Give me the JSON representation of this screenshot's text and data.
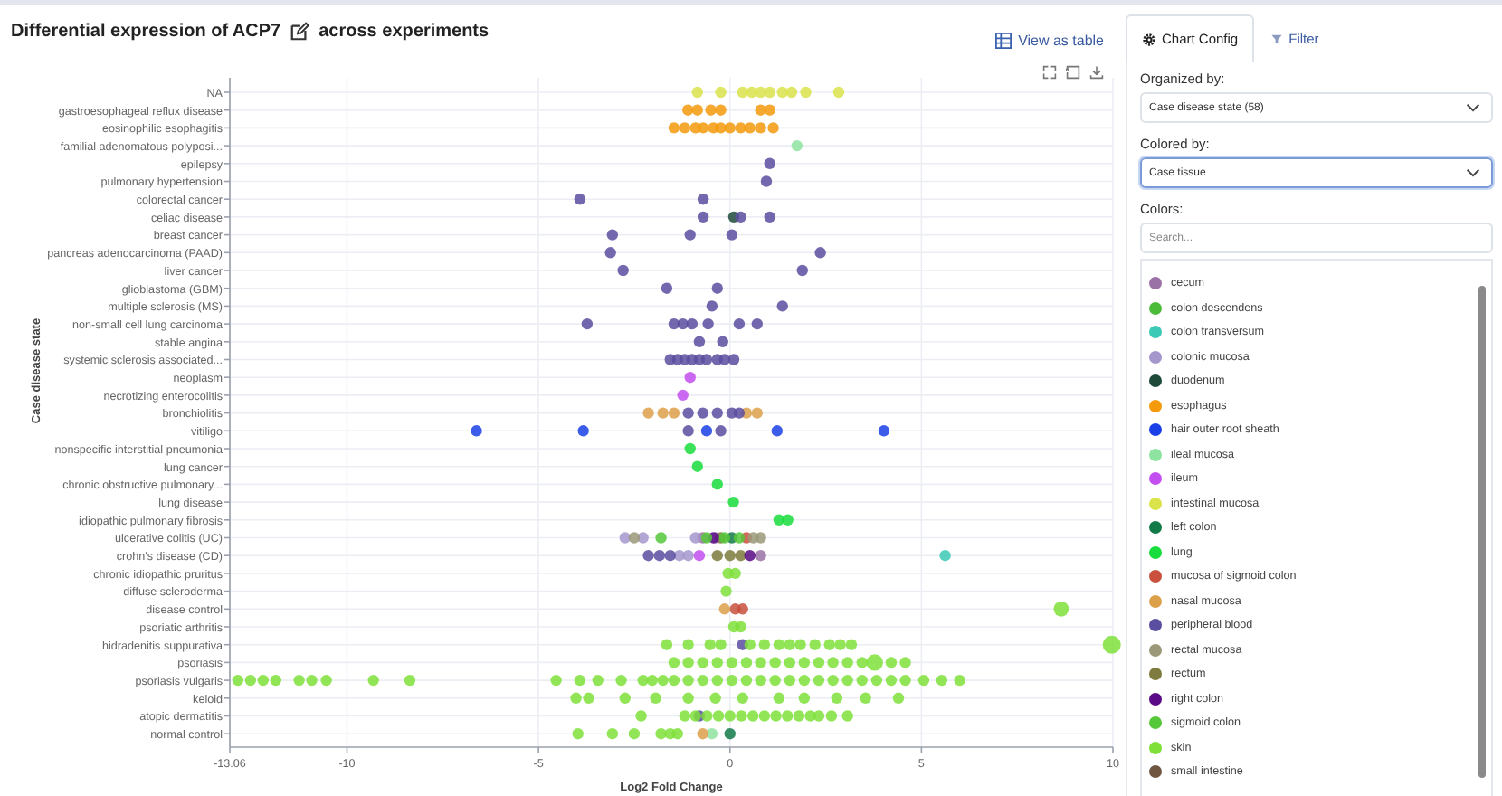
{
  "header": {
    "title_before": "Differential expression of ACP7",
    "title_after": "across experiments",
    "view_as_table": "View as table"
  },
  "tabs": [
    {
      "label": "Chart Config",
      "selected": true
    },
    {
      "label": "Filter",
      "selected": false
    }
  ],
  "config": {
    "organized_label": "Organized by:",
    "organized_value": "Case disease state (58)",
    "colored_label": "Colored by:",
    "colored_value": "Case tissue",
    "colors_label": "Colors:",
    "search_placeholder": "Search...",
    "colors": [
      {
        "label": "cecum",
        "color": "#9b72a6"
      },
      {
        "label": "colon descendens",
        "color": "#4cbb3a"
      },
      {
        "label": "colon transversum",
        "color": "#3cc9b5"
      },
      {
        "label": "colonic mucosa",
        "color": "#a597cc"
      },
      {
        "label": "duodenum",
        "color": "#1f4a3a"
      },
      {
        "label": "esophagus",
        "color": "#f59a0c"
      },
      {
        "label": "hair outer root sheath",
        "color": "#1a3fe6"
      },
      {
        "label": "ileal mucosa",
        "color": "#8fe3a1"
      },
      {
        "label": "ileum",
        "color": "#c34ff0"
      },
      {
        "label": "intestinal mucosa",
        "color": "#dbe34b"
      },
      {
        "label": "left colon",
        "color": "#127a48"
      },
      {
        "label": "lung",
        "color": "#19dd3c"
      },
      {
        "label": "mucosa of sigmoid colon",
        "color": "#c8503d"
      },
      {
        "label": "nasal mucosa",
        "color": "#dda04a"
      },
      {
        "label": "peripheral blood",
        "color": "#5a4ea0"
      },
      {
        "label": "rectal mucosa",
        "color": "#9a9878"
      },
      {
        "label": "rectum",
        "color": "#7d7b3d"
      },
      {
        "label": "right colon",
        "color": "#5a0a86"
      },
      {
        "label": "sigmoid colon",
        "color": "#55c83a"
      },
      {
        "label": "skin",
        "color": "#7fe03a"
      },
      {
        "label": "small intestine",
        "color": "#6e5640"
      }
    ]
  },
  "plot": {
    "xlabel": "Log2 Fold Change",
    "ylabel": "Case disease state",
    "xticks": [
      "-13.06",
      "-10",
      "-5",
      "0",
      "5",
      "10"
    ],
    "categories": [
      "NA",
      "gastroesophageal reflux disease",
      "eosinophilic esophagitis",
      "familial adenomatous polyposi...",
      "epilepsy",
      "pulmonary hypertension",
      "colorectal cancer",
      "celiac disease",
      "breast cancer",
      "pancreas adenocarcinoma (PAAD)",
      "liver cancer",
      "glioblastoma (GBM)",
      "multiple sclerosis (MS)",
      "non-small cell lung carcinoma",
      "stable angina",
      "systemic sclerosis associated...",
      "neoplasm",
      "necrotizing enterocolitis",
      "bronchiolitis",
      "vitiligo",
      "nonspecific interstitial pneumonia",
      "lung cancer",
      "chronic obstructive pulmonary...",
      "lung disease",
      "idiopathic pulmonary fibrosis",
      "ulcerative colitis (UC)",
      "crohn's disease (CD)",
      "chronic idiopathic pruritus",
      "diffuse scleroderma",
      "disease control",
      "psoriatic arthritis",
      "hidradenitis suppurativa",
      "psoriasis",
      "psoriasis vulgaris",
      "keloid",
      "atopic dermatitis",
      "normal control"
    ]
  }
}
